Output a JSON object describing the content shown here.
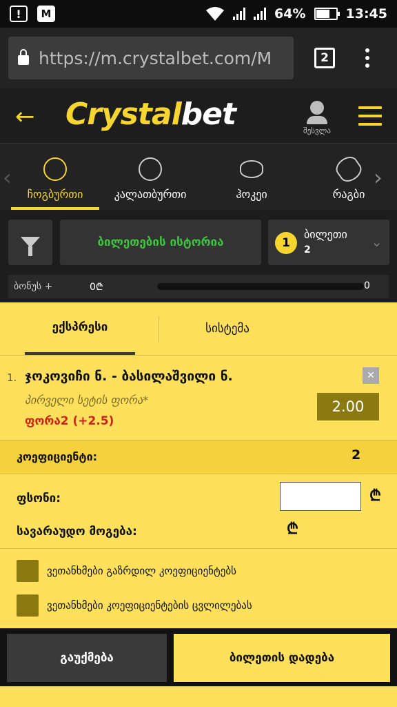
{
  "status_bar": {
    "battery": "64%",
    "battery_level": 0.64,
    "time": "13:45"
  },
  "browser": {
    "url": "https://m.crystalbet.com/M",
    "tabs_count": "2"
  },
  "header": {
    "logo_primary": "Crystal",
    "logo_secondary": "bet",
    "login_label": "შესვლა"
  },
  "sports": [
    {
      "label": "ჩოგბურთი",
      "icon": "tennis-ball-icon",
      "active": true
    },
    {
      "label": "კალათბურთი",
      "icon": "basketball-icon",
      "active": false
    },
    {
      "label": "ჰოკეი",
      "icon": "hockey-puck-icon",
      "active": false
    },
    {
      "label": "რაგბი",
      "icon": "rugby-ball-icon",
      "active": false
    }
  ],
  "controls": {
    "history_label": "ბილეთების ისტორია",
    "ticket_badge": "1",
    "ticket_label": "ბილეთი",
    "ticket_number": "2",
    "bonus_label": "ბონუს +",
    "bonus_value": "0₾",
    "bonus_end": "0"
  },
  "panel": {
    "tab_express": "ექსპრესი",
    "tab_system": "სისტემა",
    "bet": {
      "number": "1.",
      "match": "ჯოკოვიჩი ნ. - ბასილაშვილი ნ.",
      "market": "პირველი სეტის ფორა*",
      "selection": "ფორა2 (+2.5)",
      "odds": "2.00"
    },
    "coef_label": "კოეფიციენტი:",
    "coef_value": "2",
    "stake_label": "ფსონი:",
    "stake_value": "",
    "currency": "₾",
    "potential_win_label": "სავარაუდო მოგება:",
    "check_increase": "ვეთანხმები გაზრდილ კოეფიციენტებს",
    "check_change": "ვეთანხმები კოეფიციენტების ცვლილებას"
  },
  "footer": {
    "cancel_label": "გაუქმება",
    "place_label": "ბილეთის დადება"
  },
  "colors": {
    "accent": "#f6d532",
    "panel": "#fee05c",
    "odds_box": "#8b7a10",
    "selection_red": "#d0211b",
    "history_green": "#3ec33e"
  }
}
